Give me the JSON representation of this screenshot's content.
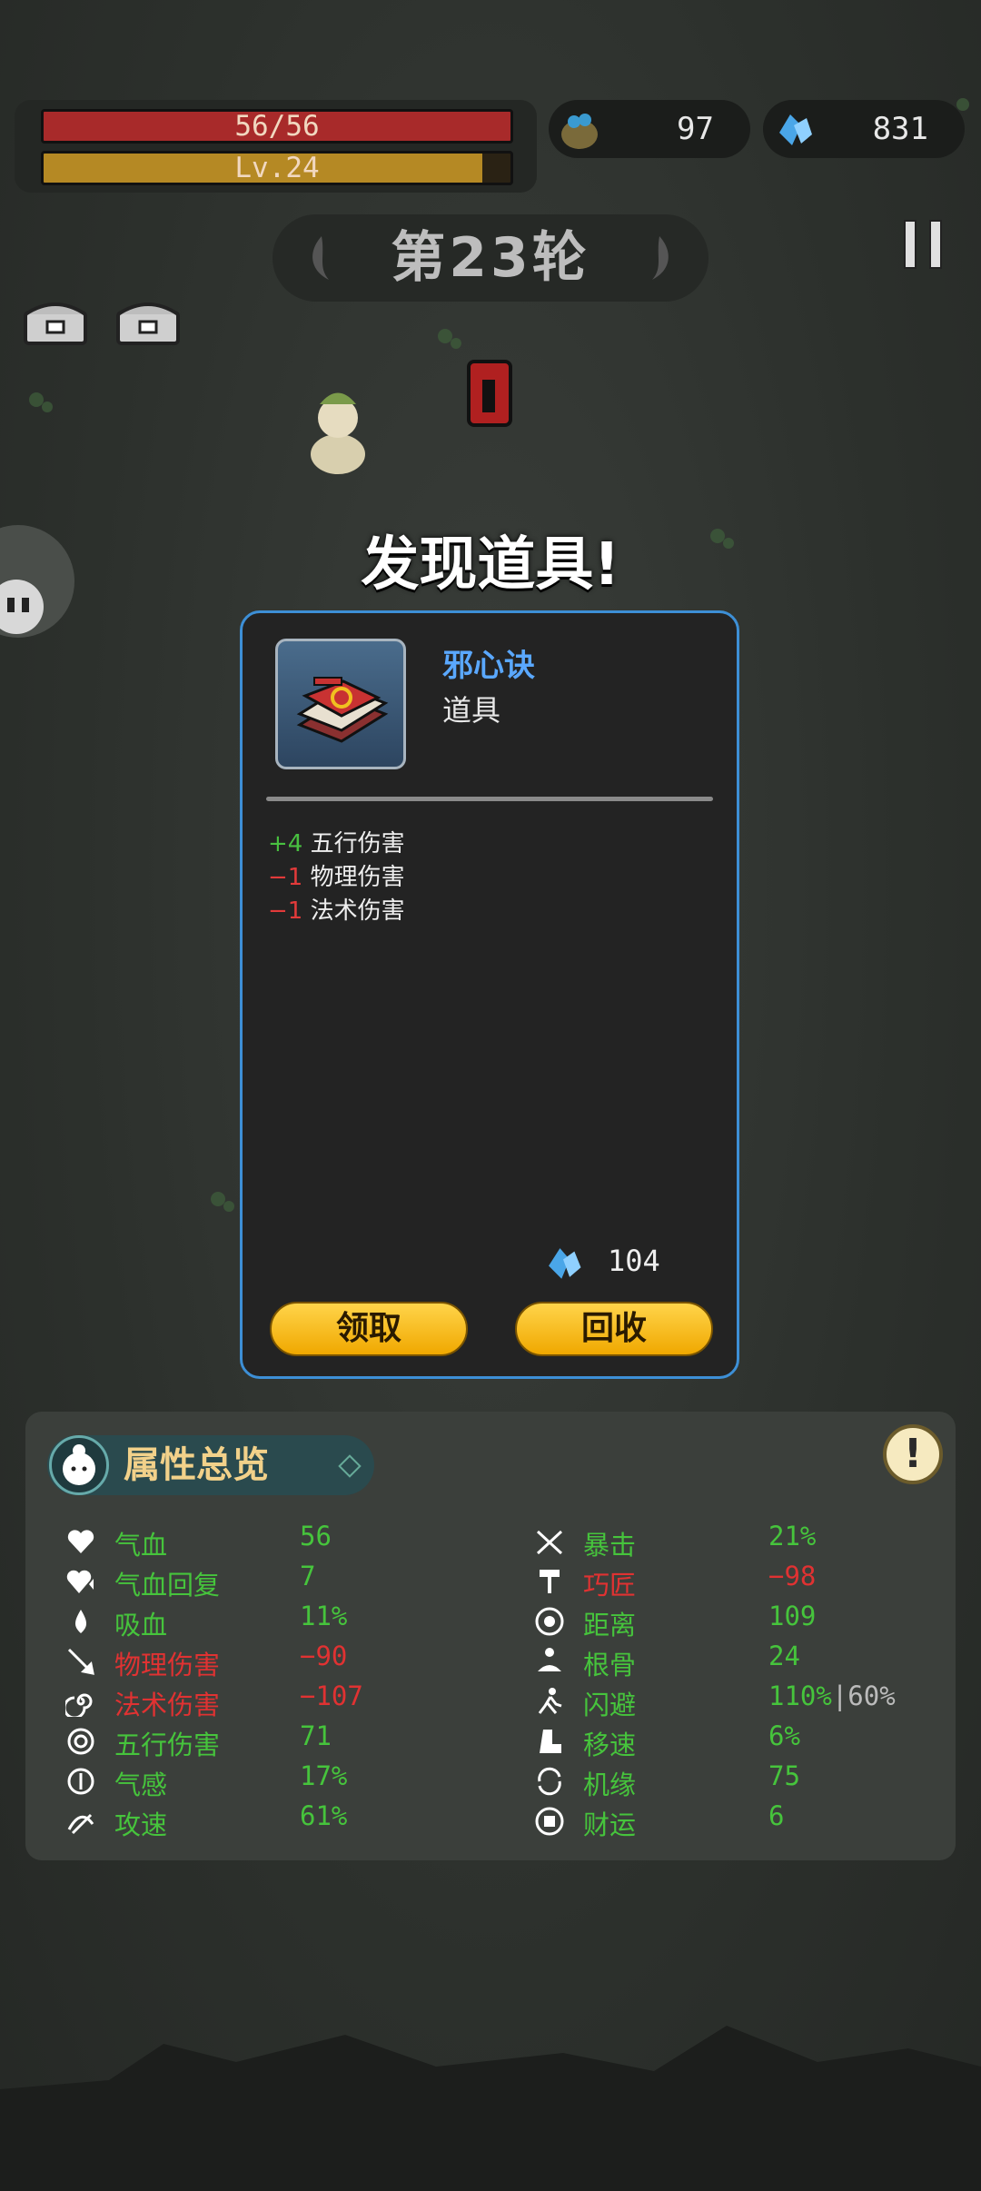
{
  "hud": {
    "hp_text": "56/56",
    "hp_fraction": 1.0,
    "level_text": "Lv.24",
    "level_fraction": 0.94,
    "coins": "97",
    "gems": "831"
  },
  "round_title": "第23轮",
  "modal": {
    "title": "发现道具!",
    "item_name": "邪心诀",
    "item_type": "道具",
    "effects": [
      {
        "sign": "+4",
        "label": "五行伤害",
        "positive": true
      },
      {
        "sign": "−1",
        "label": "物理伤害",
        "positive": false
      },
      {
        "sign": "−1",
        "label": "法术伤害",
        "positive": false
      }
    ],
    "recycle_value": "104",
    "claim_label": "领取",
    "recycle_label": "回收"
  },
  "stats": {
    "title": "属性总览",
    "info_label": "!",
    "left": [
      {
        "name": "气血",
        "value": "56",
        "icon": "heart-icon",
        "negative": false
      },
      {
        "name": "气血回复",
        "value": "7",
        "icon": "heart-regen-icon",
        "negative": false
      },
      {
        "name": "吸血",
        "value": "11%",
        "icon": "blood-drop-icon",
        "negative": false
      },
      {
        "name": "物理伤害",
        "value": "−90",
        "icon": "sword-icon",
        "negative": true
      },
      {
        "name": "法术伤害",
        "value": "−107",
        "icon": "spiral-icon",
        "negative": true
      },
      {
        "name": "五行伤害",
        "value": "71",
        "icon": "elements-icon",
        "negative": false
      },
      {
        "name": "气感",
        "value": "17%",
        "icon": "qi-icon",
        "negative": false
      },
      {
        "name": "攻速",
        "value": "61%",
        "icon": "attack-speed-icon",
        "negative": false
      }
    ],
    "right": [
      {
        "name": "暴击",
        "value": "21%",
        "icon": "crit-icon",
        "negative": false
      },
      {
        "name": "巧匠",
        "value": "−98",
        "icon": "hammer-icon",
        "negative": true
      },
      {
        "name": "距离",
        "value": "109",
        "icon": "range-icon",
        "negative": false
      },
      {
        "name": "根骨",
        "value": "24",
        "icon": "meditate-icon",
        "negative": false
      },
      {
        "name": "闪避",
        "value": "110%",
        "value_suffix": "|60%",
        "icon": "dodge-icon",
        "negative": false
      },
      {
        "name": "移速",
        "value": "6%",
        "icon": "boot-icon",
        "negative": false
      },
      {
        "name": "机缘",
        "value": "75",
        "icon": "fortune-cycle-icon",
        "negative": false
      },
      {
        "name": "财运",
        "value": "6",
        "icon": "coin-luck-icon",
        "negative": false
      }
    ]
  },
  "colors": {
    "positive": "#46c43c",
    "negative": "#e03232",
    "accent_border": "#3d8fd6",
    "button": "#f5b90a"
  }
}
